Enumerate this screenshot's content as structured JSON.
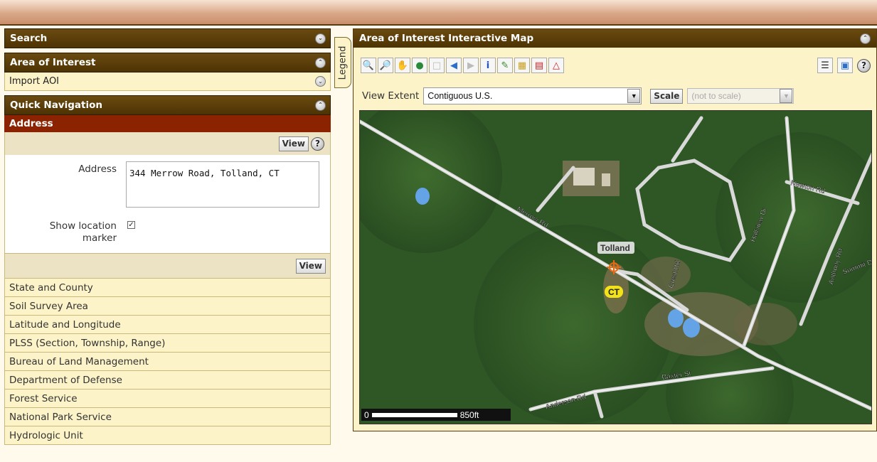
{
  "left_panel": {
    "search_header": "Search",
    "aoi_header": "Area of Interest",
    "import_aoi": "Import AOI",
    "quick_nav_header": "Quick Navigation",
    "address_header": "Address",
    "view_label": "View",
    "address_label": "Address",
    "address_value": "344 Merrow Road, Tolland, CT",
    "show_marker_label_1": "Show location",
    "show_marker_label_2": "marker",
    "show_marker_checked": true,
    "nav_items": [
      "State and County",
      "Soil Survey Area",
      "Latitude and Longitude",
      "PLSS (Section, Township, Range)",
      "Bureau of Land Management",
      "Department of Defense",
      "Forest Service",
      "National Park Service",
      "Hydrologic Unit"
    ]
  },
  "legend_tab": "Legend",
  "map_panel": {
    "header": "Area of Interest Interactive Map",
    "view_extent_label": "View Extent",
    "view_extent_value": "Contiguous U.S.",
    "scale_button": "Scale",
    "scale_value": "(not to scale)",
    "scalebar_start": "0",
    "scalebar_end": "850ft",
    "map_labels": {
      "road1": "Merrow Rd",
      "road2": "Crest Rd",
      "road3": "Hallview Dr",
      "road4": "Newton Rd",
      "road5": "Anthony Rd",
      "road6": "Summit Dr",
      "road7": "Baxter St",
      "road8": "Anderson Rd",
      "town": "Tolland",
      "state": "CT"
    }
  },
  "colors": {
    "header_brown": "#4d3304",
    "address_red": "#8c2300",
    "panel_cream": "#fdf3c8"
  }
}
